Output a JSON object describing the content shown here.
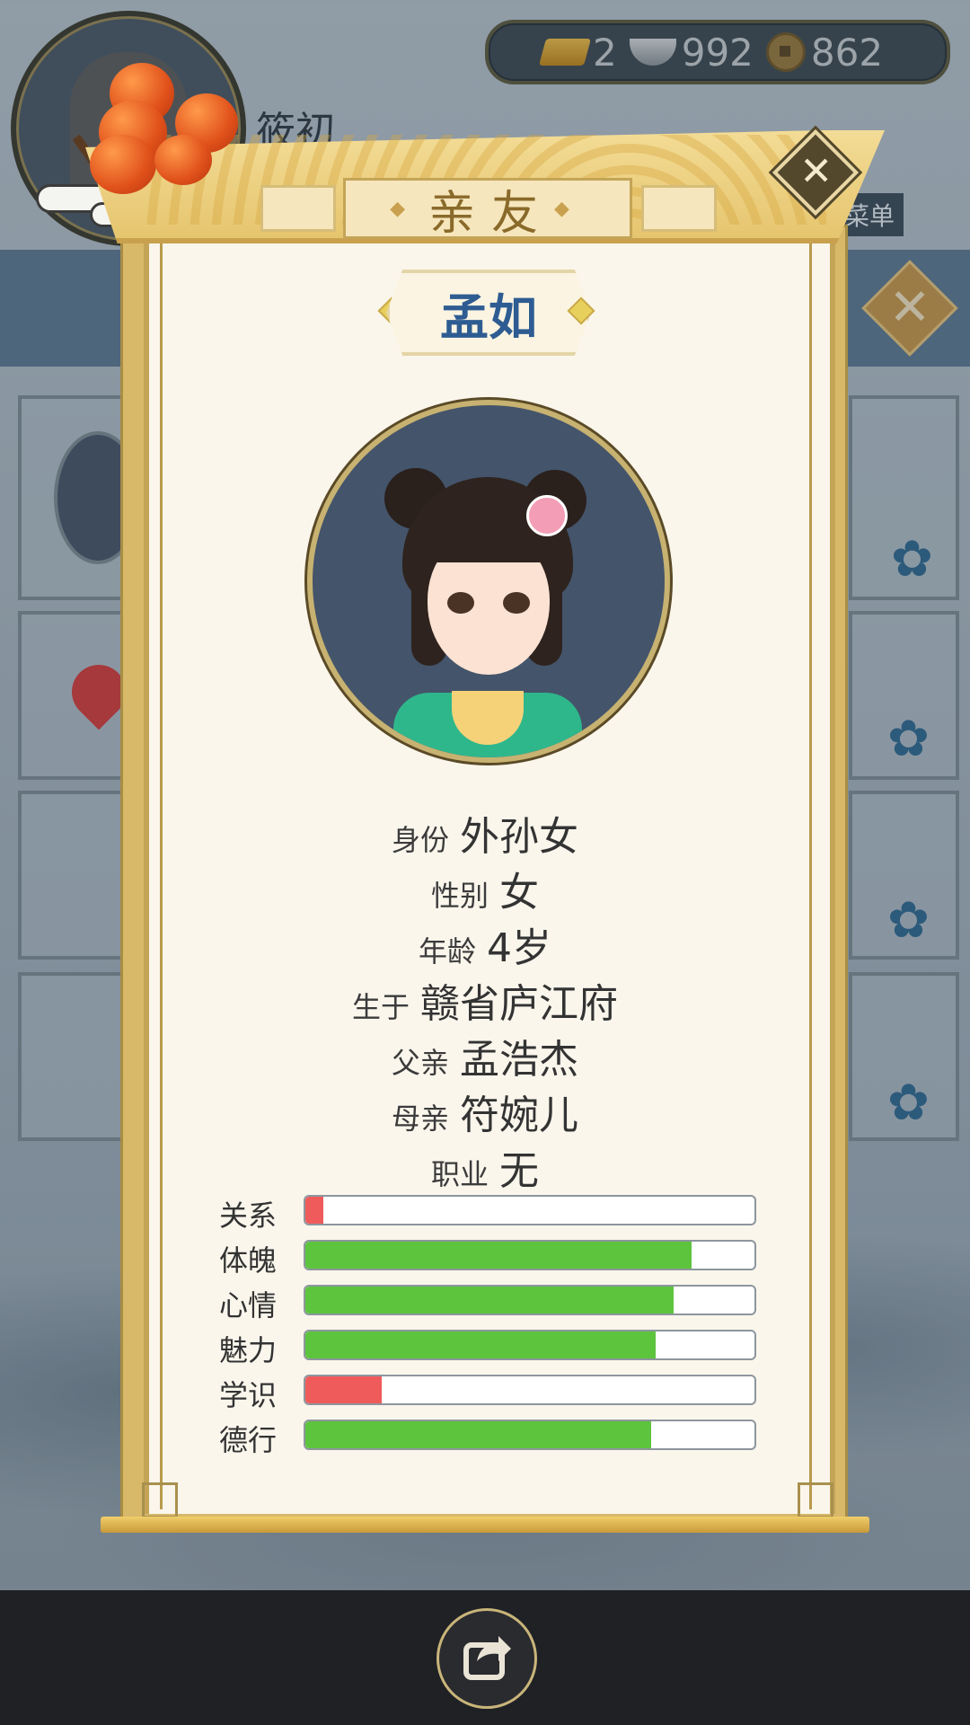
{
  "background": {
    "name_partial": "筱初",
    "currency": {
      "gold": "2",
      "silver": "992",
      "coins": "862",
      "gold_icon": "gold-ingot-icon",
      "silver_icon": "silver-ingot-icon",
      "coin_icon": "copper-coin-icon"
    },
    "menu_partial": "菜单"
  },
  "modal": {
    "title": "亲友",
    "name": "孟如",
    "info": [
      {
        "label": "身份",
        "value": "外孙女"
      },
      {
        "label": "性别",
        "value": "女"
      },
      {
        "label": "年龄",
        "value": "4岁"
      },
      {
        "label": "生于",
        "value": "赣省庐江府"
      },
      {
        "label": "父亲",
        "value": "孟浩杰"
      },
      {
        "label": "母亲",
        "value": "符婉儿"
      },
      {
        "label": "职业",
        "value": "无"
      }
    ],
    "stats": [
      {
        "label": "关系",
        "value": 0.04,
        "color": "#ef5b5b"
      },
      {
        "label": "体魄",
        "value": 0.86,
        "color": "#5dc43e"
      },
      {
        "label": "心情",
        "value": 0.82,
        "color": "#5dc43e"
      },
      {
        "label": "魅力",
        "value": 0.78,
        "color": "#5dc43e"
      },
      {
        "label": "学识",
        "value": 0.17,
        "color": "#ef5b5b"
      },
      {
        "label": "德行",
        "value": 0.77,
        "color": "#5dc43e"
      }
    ]
  },
  "bottom": {
    "share_icon": "share-icon"
  }
}
